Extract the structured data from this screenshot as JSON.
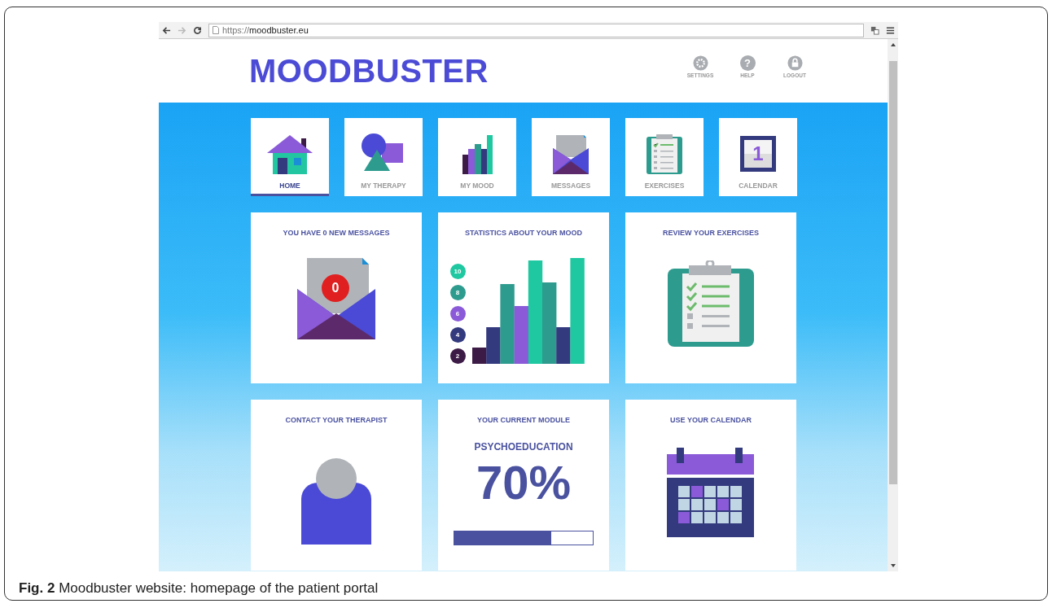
{
  "browser": {
    "url_scheme": "https://",
    "url_host": "moodbuster.eu"
  },
  "header": {
    "logo": "MOODBUSTER",
    "actions": [
      {
        "kind": "settings",
        "label": "SETTINGS"
      },
      {
        "kind": "help",
        "label": "HELP",
        "icon_text": "?"
      },
      {
        "kind": "logout",
        "label": "LOGOUT"
      }
    ]
  },
  "nav": [
    {
      "kind": "home",
      "label": "HOME",
      "selected": true
    },
    {
      "kind": "therapy",
      "label": "MY THERAPY",
      "selected": false
    },
    {
      "kind": "mood",
      "label": "MY MOOD",
      "selected": false
    },
    {
      "kind": "messages",
      "label": "MESSAGES",
      "selected": false
    },
    {
      "kind": "exercises",
      "label": "EXERCISES",
      "selected": false
    },
    {
      "kind": "calendar",
      "label": "CALENDAR",
      "selected": false,
      "icon_text": "1"
    }
  ],
  "cards": [
    {
      "kind": "messages",
      "title": "YOU HAVE 0 NEW MESSAGES",
      "badge": "0"
    },
    {
      "kind": "mood",
      "title": "STATISTICS ABOUT YOUR MOOD",
      "scale": [
        {
          "label": "10",
          "color": "#1fc8a0"
        },
        {
          "label": "8",
          "color": "#2e9b8f"
        },
        {
          "label": "6",
          "color": "#8a5ad8"
        },
        {
          "label": "4",
          "color": "#333a7e"
        },
        {
          "label": "2",
          "color": "#3d1b47"
        }
      ]
    },
    {
      "kind": "exercises",
      "title": "REVIEW YOUR EXERCISES"
    },
    {
      "kind": "therapist",
      "title": "CONTACT YOUR THERAPIST"
    },
    {
      "kind": "module",
      "title": "YOUR CURRENT MODULE",
      "module": "PSYCHOEDUCATION",
      "percent": "70%",
      "level": 0.7
    },
    {
      "kind": "calendar",
      "title": "USE YOUR CALENDAR"
    }
  ],
  "caption": "**Fig. 2** Moodbuster website: homepage of the patient portal"
}
